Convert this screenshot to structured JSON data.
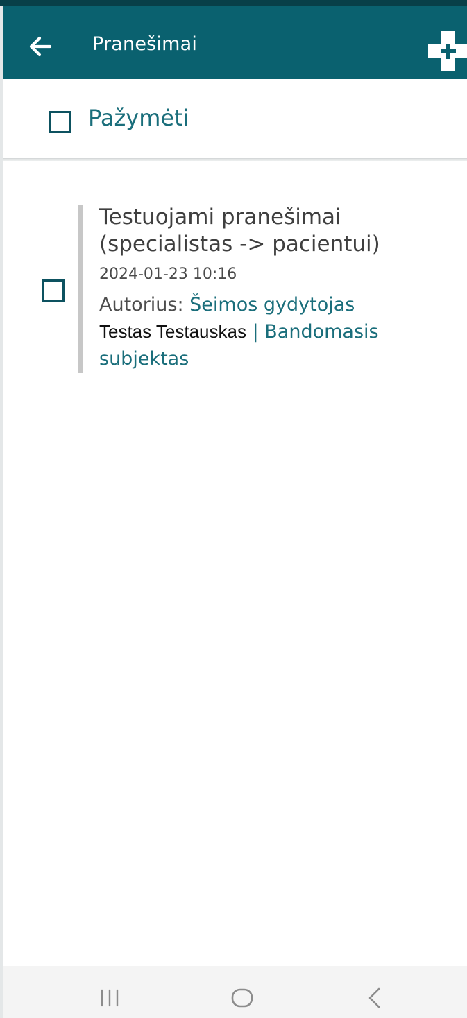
{
  "appbar": {
    "title": "Pranešimai",
    "back_icon": "arrow-left-icon",
    "add_icon": "medical-cross-plus-icon"
  },
  "select_all": {
    "label": "Pažymėti",
    "checked": false
  },
  "messages": [
    {
      "title": "Testuojami pranešimai (specialistas -> pacientui)",
      "datetime": "2024-01-23 10:16",
      "author_label": "Autorius:",
      "author_role": "Šeimos gydytojas",
      "recipient_name": "Testas Testauskas",
      "recipient_separator": "|",
      "recipient_type": "Bandomasis subjektas",
      "checked": false
    }
  ],
  "system_nav": {
    "recents_icon": "recents-icon",
    "home_icon": "home-icon",
    "back_icon": "nav-back-icon"
  },
  "colors": {
    "appbar_bg": "#0a616f",
    "accent_text": "#1a6e7b",
    "checkbox_border": "#0d5260",
    "item_bar": "#c7c7c7",
    "nav_bg": "#f4f4f4"
  }
}
